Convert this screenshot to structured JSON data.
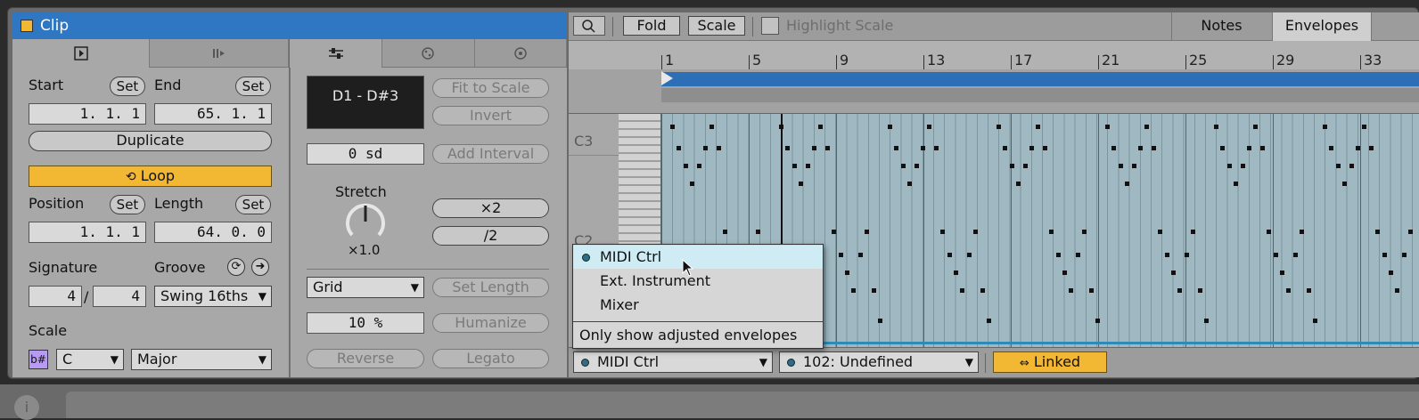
{
  "clip": {
    "title": "Clip",
    "start_label": "Start",
    "end_label": "End",
    "set_label": "Set",
    "start_value": "1.  1.  1",
    "end_value": "65.  1.  1",
    "duplicate_label": "Duplicate",
    "loop_label": "Loop",
    "position_label": "Position",
    "length_label": "Length",
    "position_value": "1.  1.  1",
    "length_value": "64.  0.  0",
    "signature_label": "Signature",
    "groove_label": "Groove",
    "sig_num": "4",
    "sig_den": "4",
    "sig_sep": "/",
    "groove_value": "Swing 16ths",
    "scale_label": "Scale",
    "scale_root": "C",
    "scale_mode": "Major",
    "scale_badge": "b#"
  },
  "transform": {
    "range_display": "D1 - D#3",
    "fit_to_scale": "Fit to Scale",
    "invert": "Invert",
    "sd_value": "0 sd",
    "add_interval": "Add Interval",
    "stretch_label": "Stretch",
    "stretch_value": "×1.0",
    "x2": "×2",
    "div2": "/2",
    "grid_value": "Grid",
    "set_length": "Set Length",
    "percent_value": "10 %",
    "humanize": "Humanize",
    "reverse": "Reverse",
    "legato": "Legato"
  },
  "editor": {
    "fold": "Fold",
    "scale": "Scale",
    "highlight_scale": "Highlight Scale",
    "notes_tab": "Notes",
    "envelopes_tab": "Envelopes",
    "bars": [
      "1",
      "5",
      "9",
      "13",
      "17",
      "21",
      "25",
      "29",
      "33"
    ],
    "note_c3": "C3",
    "note_c2": "C2",
    "device_select": "MIDI Ctrl",
    "param_select": "102: Undefined",
    "linked_label": "Linked"
  },
  "menu": {
    "items": [
      "MIDI Ctrl",
      "Ext. Instrument",
      "Mixer"
    ],
    "only_adjusted": "Only show adjusted envelopes"
  },
  "colors": {
    "accent": "#f2b733",
    "title_bar": "#2f77c3",
    "loop_bar": "#2d6fb6",
    "grid_bg": "#9fb8c2"
  }
}
